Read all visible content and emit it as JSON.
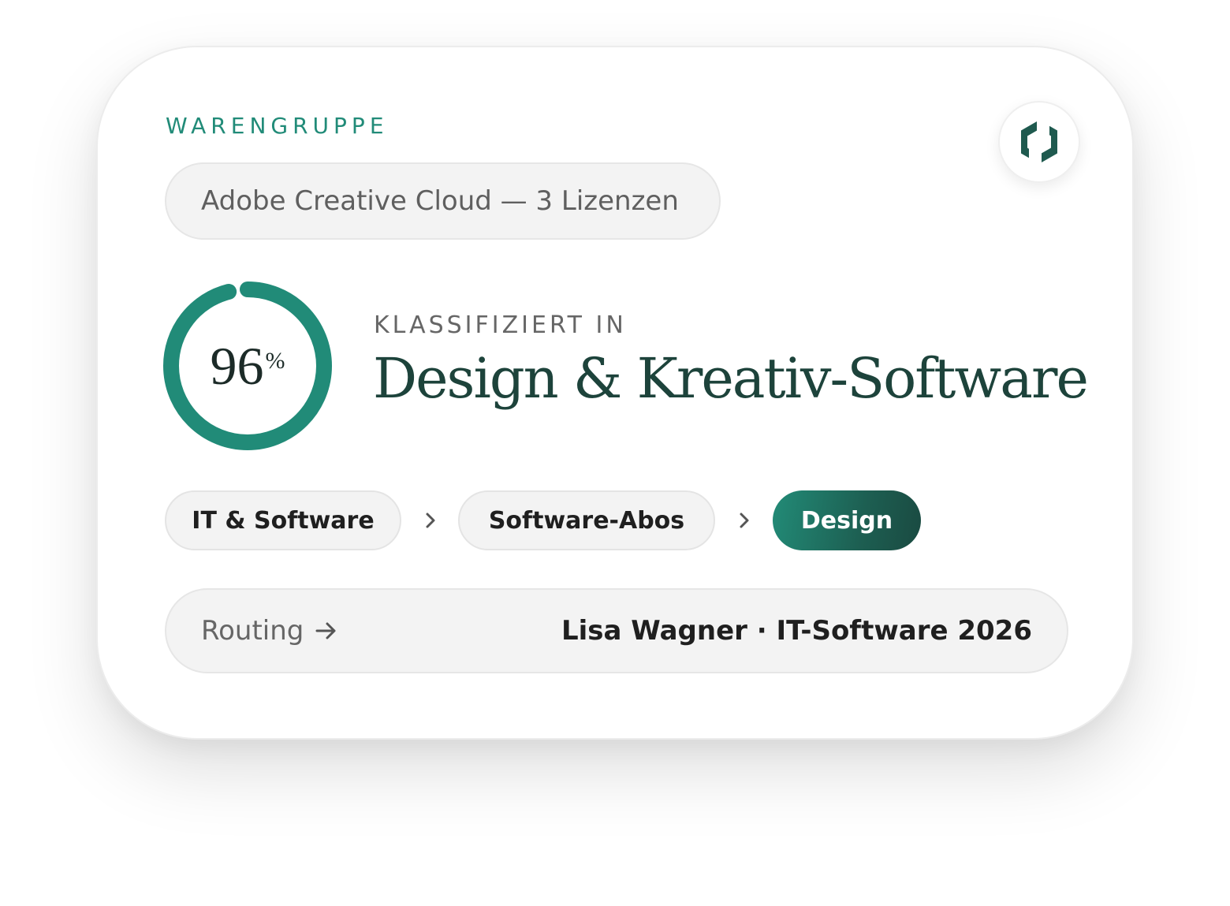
{
  "card": {
    "section_label": "WARENGRUPPE",
    "product": "Adobe Creative Cloud — 3 Lizenzen",
    "confidence": {
      "value": 96,
      "number_text": "96",
      "unit": "%"
    },
    "classified_label": "KLASSIFIZIERT IN",
    "category_title": "Design & Kreativ-Software",
    "breadcrumb": [
      {
        "label": "IT & Software",
        "active": false
      },
      {
        "label": "Software-Abos",
        "active": false
      },
      {
        "label": "Design",
        "active": true
      }
    ],
    "routing": {
      "label": "Routing",
      "value": "Lisa Wagner · IT-Software 2026"
    }
  },
  "colors": {
    "accent": "#218b78",
    "accent_dark": "#1d433b",
    "ring_track": "#218b78"
  },
  "icons": {
    "logo": "hexagon-bracket-logo-icon",
    "chevron": "chevron-right-icon",
    "arrow": "arrow-right-icon"
  }
}
